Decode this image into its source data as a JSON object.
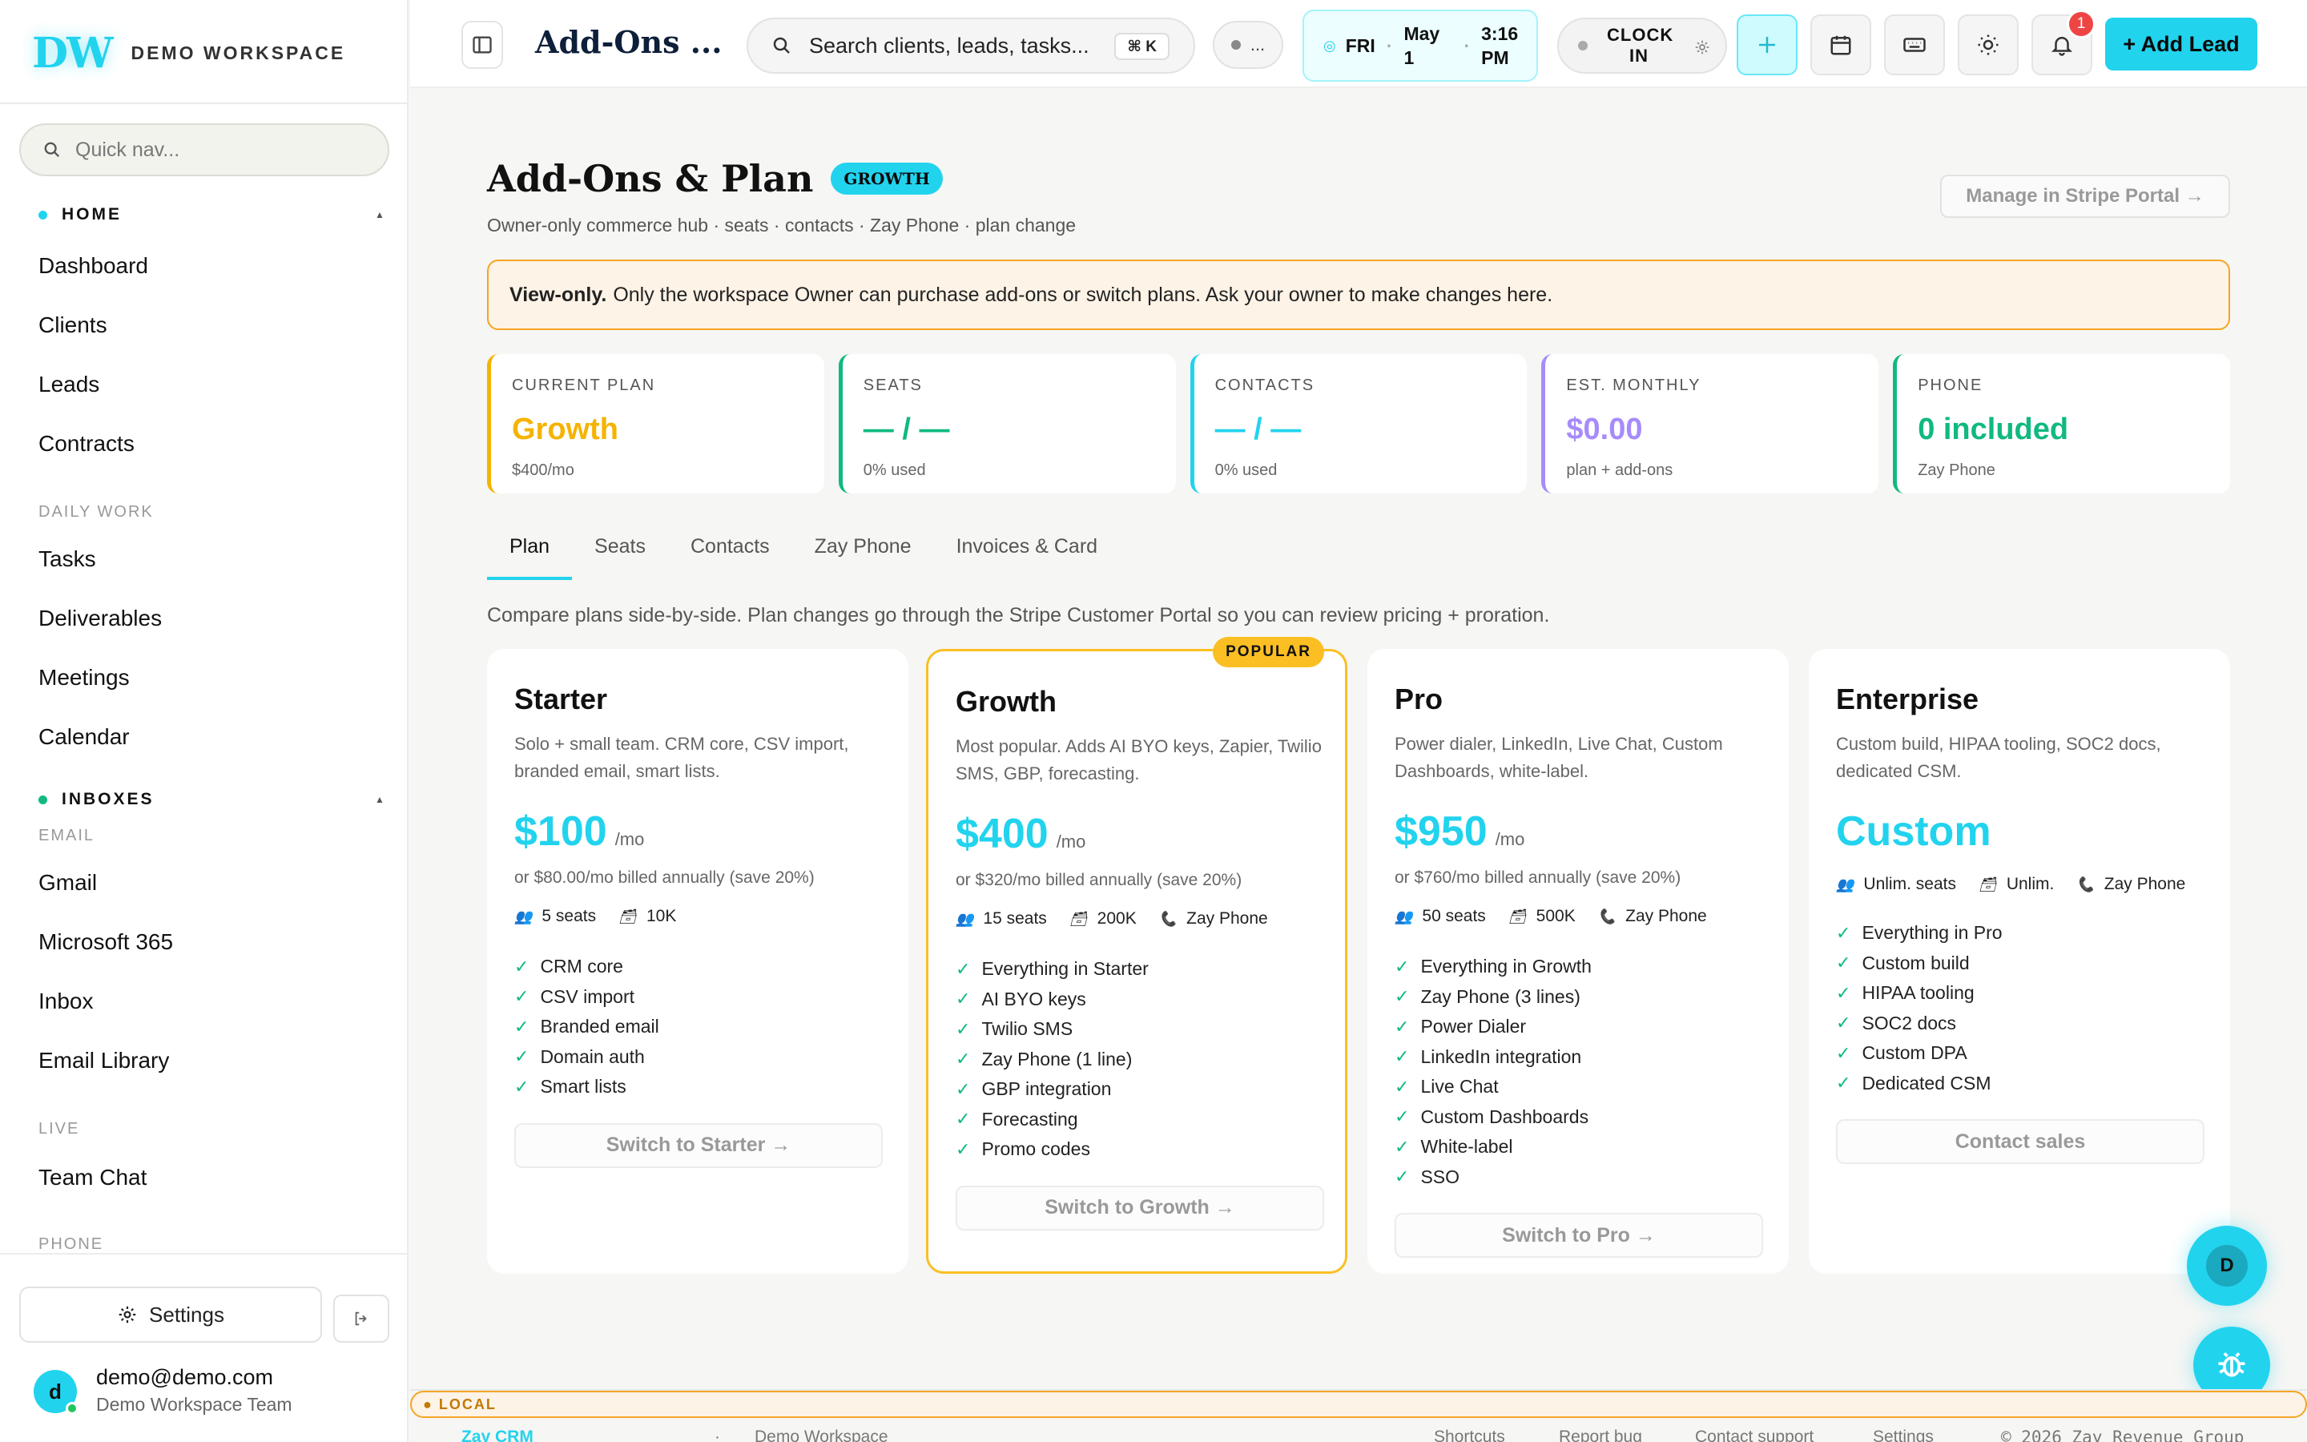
{
  "sidebar": {
    "logo": "DW",
    "workspace_name": "DEMO WORKSPACE",
    "quick_nav_placeholder": "Quick nav...",
    "home_section": "HOME",
    "home_items": [
      "Dashboard",
      "Clients",
      "Leads",
      "Contracts"
    ],
    "daily_work_label": "DAILY WORK",
    "daily_items": [
      "Tasks",
      "Deliverables",
      "Meetings",
      "Calendar"
    ],
    "inboxes_section": "INBOXES",
    "email_label": "EMAIL",
    "email_items": [
      "Gmail",
      "Microsoft 365",
      "Inbox",
      "Email Library"
    ],
    "live_label": "LIVE",
    "live_items": [
      "Team Chat"
    ],
    "phone_label": "PHONE",
    "settings_label": "Settings",
    "user_initial": "d",
    "user_email": "demo@demo.com",
    "user_team": "Demo Workspace Team"
  },
  "header": {
    "title": "Add-Ons ...",
    "search_placeholder": "Search clients, leads, tasks...",
    "search_shortcut": "⌘ K",
    "status_text": "...",
    "clock_day": "FRI",
    "clock_date": "May 1",
    "clock_time": "3:16 PM",
    "clock_in_label": "CLOCK IN",
    "notification_count": "1",
    "add_lead_label": "+ Add Lead"
  },
  "page": {
    "title": "Add-Ons & Plan",
    "plan_badge": "GROWTH",
    "subtitle": "Owner-only commerce hub · seats · contacts · Zay Phone · plan change",
    "stripe_button": "Manage in Stripe Portal →",
    "notice_bold": "View-only.",
    "notice_text": "Only the workspace Owner can purchase add-ons or switch plans. Ask your owner to make changes here.",
    "compare_note": "Compare plans side-by-side. Plan changes go through the Stripe Customer Portal so you can review pricing + proration."
  },
  "stats": [
    {
      "label": "CURRENT PLAN",
      "value": "Growth",
      "hint": "$400/mo",
      "color": "#f5b301"
    },
    {
      "label": "SEATS",
      "value": "— / —",
      "hint": "0% used",
      "color": "#10b981"
    },
    {
      "label": "CONTACTS",
      "value": "— / —",
      "hint": "0% used",
      "color": "#22d3ee"
    },
    {
      "label": "EST. MONTHLY",
      "value": "$0.00",
      "hint": "plan + add-ons",
      "color": "#a78bfa"
    },
    {
      "label": "PHONE",
      "value": "0 included",
      "hint": "Zay Phone",
      "color": "#10b981"
    }
  ],
  "tabs": [
    "Plan",
    "Seats",
    "Contacts",
    "Zay Phone",
    "Invoices & Card"
  ],
  "plans": [
    {
      "name": "Starter",
      "desc": "Solo + small team. CRM core, CSV import, branded email, smart lists.",
      "price": "$100",
      "per": "/mo",
      "annual": "or $80.00/mo billed annually (save 20%)",
      "seats": "5 seats",
      "contacts": "10K",
      "phone": "",
      "features": [
        "CRM core",
        "CSV import",
        "Branded email",
        "Domain auth",
        "Smart lists"
      ],
      "button": "Switch to Starter →"
    },
    {
      "name": "Growth",
      "badge": "POPULAR",
      "desc": "Most popular. Adds AI BYO keys, Zapier, Twilio SMS, GBP, forecasting.",
      "price": "$400",
      "per": "/mo",
      "annual": "or $320/mo billed annually (save 20%)",
      "seats": "15 seats",
      "contacts": "200K",
      "phone": "Zay Phone",
      "features": [
        "Everything in Starter",
        "AI BYO keys",
        "Twilio SMS",
        "Zay Phone (1 line)",
        "GBP integration",
        "Forecasting",
        "Promo codes"
      ],
      "button": "Switch to Growth →"
    },
    {
      "name": "Pro",
      "desc": "Power dialer, LinkedIn, Live Chat, Custom Dashboards, white-label.",
      "price": "$950",
      "per": "/mo",
      "annual": "or $760/mo billed annually (save 20%)",
      "seats": "50 seats",
      "contacts": "500K",
      "phone": "Zay Phone",
      "features": [
        "Everything in Growth",
        "Zay Phone (3 lines)",
        "Power Dialer",
        "LinkedIn integration",
        "Live Chat",
        "Custom Dashboards",
        "White-label",
        "SSO"
      ],
      "button": "Switch to Pro →"
    },
    {
      "name": "Enterprise",
      "desc": "Custom build, HIPAA tooling, SOC2 docs, dedicated CSM.",
      "price": "Custom",
      "per": "",
      "annual": "",
      "seats": "Unlim. seats",
      "contacts": "Unlim.",
      "phone": "Zay Phone",
      "features": [
        "Everything in Pro",
        "Custom build",
        "HIPAA tooling",
        "SOC2 docs",
        "Custom DPA",
        "Dedicated CSM"
      ],
      "button": "Contact sales"
    }
  ],
  "fab_initial": "D",
  "footer": {
    "brand": "Zay CRM",
    "env": "LOCAL",
    "workspace": "Demo Workspace",
    "links": [
      "Shortcuts",
      "Report bug",
      "Contact support",
      "Settings"
    ],
    "copyright": "© 2026 Zay Revenue Group"
  }
}
